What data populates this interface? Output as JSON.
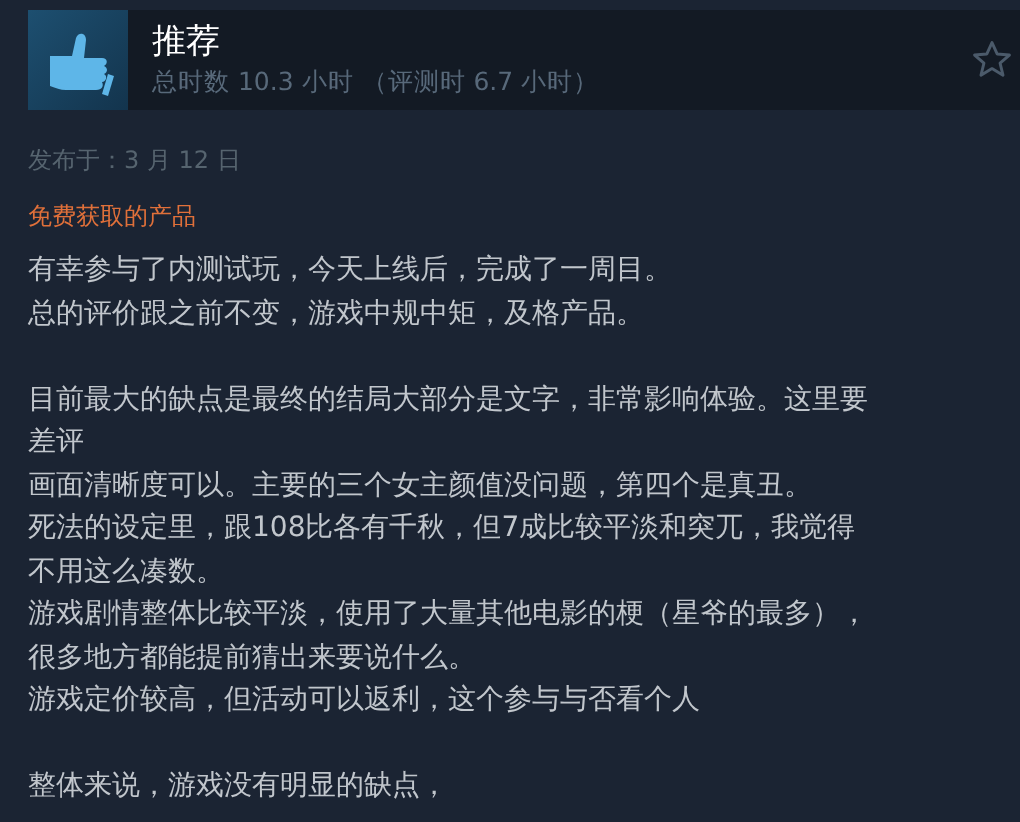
{
  "review": {
    "verdict": "推荐",
    "hours": "总时数 10.3 小时 （评测时 6.7 小时）",
    "posted": "发布于：3 月 12 日",
    "free_note": "免费获取的产品",
    "paragraphs": [
      {
        "lines": [
          "有幸参与了内测试玩，今天上线后，完成了一周目。",
          "总的评价跟之前不变，游戏中规中矩，及格产品。"
        ]
      },
      {
        "lines": [
          "目前最大的缺点是最终的结局大部分是文字，非常影响体验。这里要",
          "差评",
          "画面清晰度可以。主要的三个女主颜值没问题，第四个是真丑。",
          "死法的设定里，跟108比各有千秋，但7成比较平淡和突兀，我觉得",
          "不用这么凑数。",
          "游戏剧情整体比较平淡，使用了大量其他电影的梗（星爷的最多），",
          "很多地方都能提前猜出来要说什么。",
          "游戏定价较高，但活动可以返利，这个参与与否看个人"
        ]
      },
      {
        "lines": [
          "整体来说，游戏没有明显的缺点，"
        ]
      }
    ]
  }
}
